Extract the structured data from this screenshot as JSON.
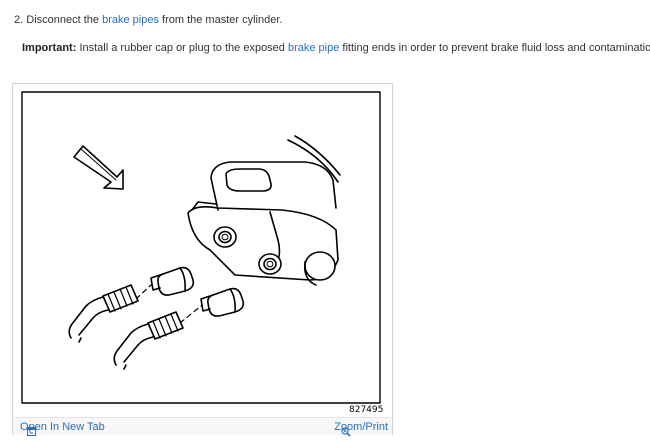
{
  "step": {
    "number": "2.",
    "text_before": "Disconnect the",
    "link": "brake pipes",
    "text_after": "from the master cylinder."
  },
  "important": {
    "label": "Important:",
    "text_before": "Install a rubber cap or plug to the exposed",
    "link": "brake pipe",
    "text_after": "fitting ends in order to prevent brake fluid loss and contamination."
  },
  "figure": {
    "code": "827495",
    "open_tab_label": "Open In New Tab",
    "open_tab_icon": "open-new-tab-icon",
    "zoom_label": "Zoom/Print",
    "zoom_icon": "magnifier-icon"
  },
  "colors": {
    "link": "#2a6ebb",
    "text": "#333333"
  }
}
